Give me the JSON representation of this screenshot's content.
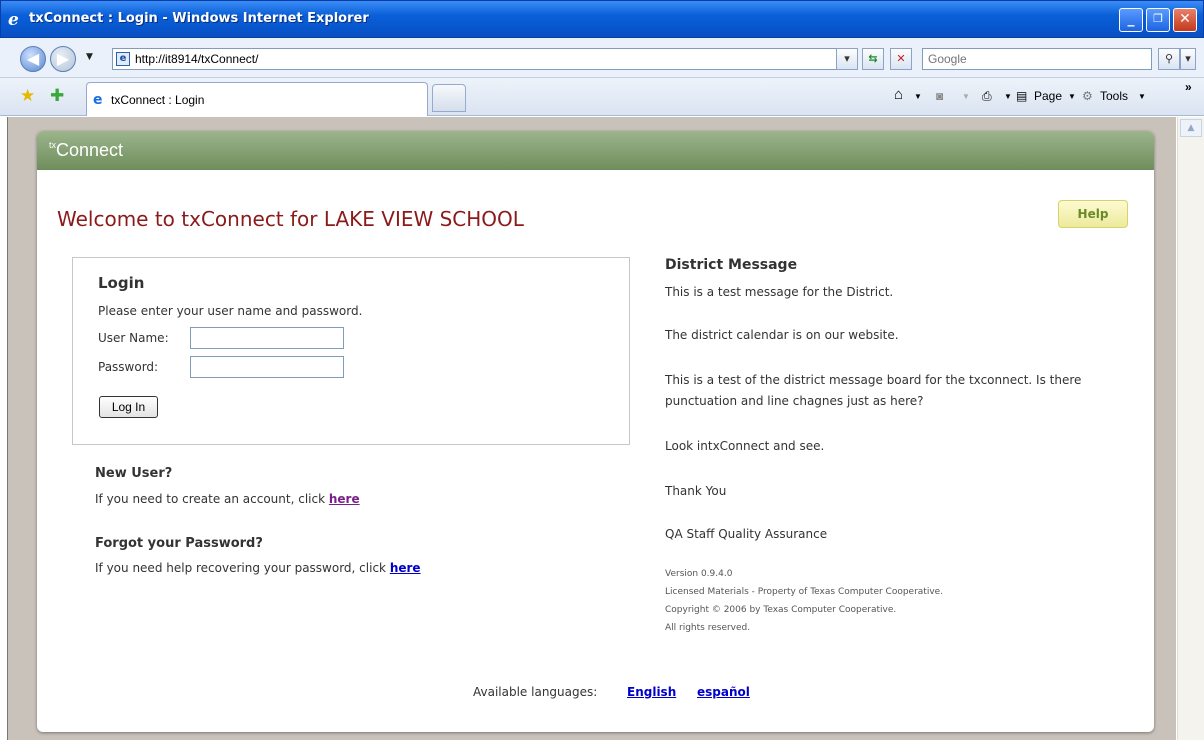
{
  "window": {
    "title": "txConnect : Login - Windows Internet Explorer",
    "minimize": "_",
    "maximize": "❐",
    "close": "✕"
  },
  "address_bar": {
    "url": "http://it8914/txConnect/",
    "search_placeholder": "Google"
  },
  "tabs": [
    {
      "label": "txConnect : Login"
    }
  ],
  "commands": {
    "page": "Page",
    "tools": "Tools",
    "overflow": "»"
  },
  "app": {
    "brand_prefix": "tx",
    "brand": "Connect",
    "welcome": "Welcome to txConnect for LAKE VIEW SCHOOL",
    "help": "Help"
  },
  "login": {
    "title": "Login",
    "instructions": "Please enter your user name and password.",
    "username_label": "User Name:",
    "password_label": "Password:",
    "username_value": "",
    "password_value": "",
    "button": "Log In"
  },
  "new_user": {
    "title": "New User?",
    "text": "If you need to create an account, click ",
    "link": "here"
  },
  "forgot": {
    "title": "Forgot your Password?",
    "text": "If you need help recovering your password, click ",
    "link": "here"
  },
  "district": {
    "title": "District Message",
    "lines": [
      "This is a test message for the District.",
      "The district calendar is on our website.",
      "This is a test of the district message board for the txconnect. Is there",
      "punctuation and line chagnes just as here?",
      "Look intxConnect and see.",
      "Thank You",
      "QA Staff Quality Assurance"
    ]
  },
  "version": {
    "lines": [
      "Version 0.9.4.0",
      "Licensed Materials - Property of Texas Computer Cooperative.",
      "Copyright © 2006 by Texas Computer Cooperative.",
      "All rights reserved."
    ]
  },
  "languages": {
    "label": "Available languages:",
    "items": [
      "English",
      "español"
    ]
  },
  "colors": {
    "header_green": "#7f9b6c",
    "welcome_red": "#8b1a1a",
    "link_blue": "#0000cc"
  }
}
